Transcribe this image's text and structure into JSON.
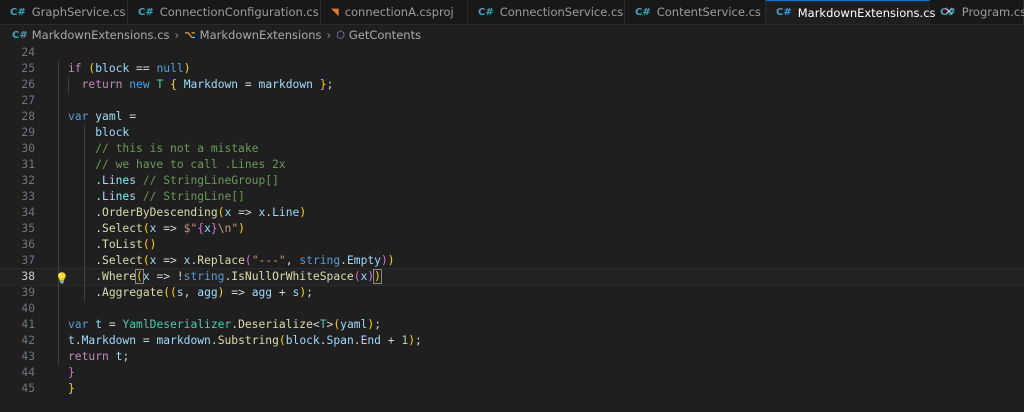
{
  "tabs": [
    {
      "label": "GraphService.cs",
      "icon": "csharp-icon",
      "glyph": "C#",
      "color": "#519aba",
      "active": false
    },
    {
      "label": "ConnectionConfiguration.cs",
      "icon": "csharp-icon",
      "glyph": "C#",
      "color": "#519aba",
      "active": false
    },
    {
      "label": "connectionA.csproj",
      "icon": "rss-icon",
      "glyph": "◥",
      "color": "#e37933",
      "active": false
    },
    {
      "label": "ConnectionService.cs",
      "icon": "csharp-icon",
      "glyph": "C#",
      "color": "#519aba",
      "active": false
    },
    {
      "label": "ContentService.cs",
      "icon": "csharp-icon",
      "glyph": "C#",
      "color": "#519aba",
      "active": false
    },
    {
      "label": "MarkdownExtensions.cs",
      "icon": "csharp-icon",
      "glyph": "C#",
      "color": "#519aba",
      "active": true
    },
    {
      "label": "Program.cs",
      "icon": "csharp-icon",
      "glyph": "C#",
      "color": "#519aba",
      "active": false
    }
  ],
  "close_glyph": "✕",
  "breadcrumb": [
    {
      "label": "MarkdownExtensions.cs",
      "icon": "csharp-icon",
      "glyph": "C#",
      "color": "#519aba"
    },
    {
      "label": "MarkdownExtensions",
      "icon": "class-icon",
      "glyph": "⌥",
      "color": "#ee9d28"
    },
    {
      "label": "GetContents",
      "icon": "method-icon",
      "glyph": "⬡",
      "color": "#b180d7"
    }
  ],
  "breadcrumb_separator": "›",
  "lightbulb": "💡",
  "current_line": 38,
  "lines": [
    {
      "n": "24",
      "tokens": []
    },
    {
      "n": "25",
      "tokens": [
        [
          "ctl",
          "if"
        ],
        [
          "pl",
          " "
        ],
        [
          "b1",
          "("
        ],
        [
          "var",
          "block"
        ],
        [
          "pl",
          " == "
        ],
        [
          "kw",
          "null"
        ],
        [
          "b1",
          ")"
        ]
      ]
    },
    {
      "n": "26",
      "tokens": [
        [
          "pl",
          "  "
        ],
        [
          "ctl",
          "return"
        ],
        [
          "pl",
          " "
        ],
        [
          "kw",
          "new"
        ],
        [
          "pl",
          " "
        ],
        [
          "ty",
          "T"
        ],
        [
          "pl",
          " "
        ],
        [
          "b1",
          "{"
        ],
        [
          "pl",
          " "
        ],
        [
          "var",
          "Markdown"
        ],
        [
          "pl",
          " = "
        ],
        [
          "var",
          "markdown"
        ],
        [
          "pl",
          " "
        ],
        [
          "b1",
          "}"
        ],
        [
          "pl",
          ";"
        ]
      ]
    },
    {
      "n": "27",
      "tokens": []
    },
    {
      "n": "28",
      "tokens": [
        [
          "kw",
          "var"
        ],
        [
          "pl",
          " "
        ],
        [
          "var",
          "yaml"
        ],
        [
          "pl",
          " ="
        ]
      ]
    },
    {
      "n": "29",
      "tokens": [
        [
          "pl",
          "    "
        ],
        [
          "var",
          "block"
        ]
      ]
    },
    {
      "n": "30",
      "tokens": [
        [
          "pl",
          "    "
        ],
        [
          "com",
          "// this is not a mistake"
        ]
      ]
    },
    {
      "n": "31",
      "tokens": [
        [
          "pl",
          "    "
        ],
        [
          "com",
          "// we have to call .Lines 2x"
        ]
      ]
    },
    {
      "n": "32",
      "tokens": [
        [
          "pl",
          "    ."
        ],
        [
          "var",
          "Lines"
        ],
        [
          "pl",
          " "
        ],
        [
          "com",
          "// StringLineGroup[]"
        ]
      ]
    },
    {
      "n": "33",
      "tokens": [
        [
          "pl",
          "    ."
        ],
        [
          "var",
          "Lines"
        ],
        [
          "pl",
          " "
        ],
        [
          "com",
          "// StringLine[]"
        ]
      ]
    },
    {
      "n": "34",
      "tokens": [
        [
          "pl",
          "    ."
        ],
        [
          "fn",
          "OrderByDescending"
        ],
        [
          "b1",
          "("
        ],
        [
          "var",
          "x"
        ],
        [
          "pl",
          " => "
        ],
        [
          "var",
          "x"
        ],
        [
          "pl",
          "."
        ],
        [
          "var",
          "Line"
        ],
        [
          "b1",
          ")"
        ]
      ]
    },
    {
      "n": "35",
      "tokens": [
        [
          "pl",
          "    ."
        ],
        [
          "fn",
          "Select"
        ],
        [
          "b1",
          "("
        ],
        [
          "var",
          "x"
        ],
        [
          "pl",
          " => "
        ],
        [
          "str",
          "$\""
        ],
        [
          "b2",
          "{"
        ],
        [
          "var",
          "x"
        ],
        [
          "b2",
          "}"
        ],
        [
          "str",
          "\\n\""
        ],
        [
          "b1",
          ")"
        ]
      ]
    },
    {
      "n": "36",
      "tokens": [
        [
          "pl",
          "    ."
        ],
        [
          "fn",
          "ToList"
        ],
        [
          "b1",
          "()"
        ]
      ]
    },
    {
      "n": "37",
      "tokens": [
        [
          "pl",
          "    ."
        ],
        [
          "fn",
          "Select"
        ],
        [
          "b1",
          "("
        ],
        [
          "var",
          "x"
        ],
        [
          "pl",
          " => "
        ],
        [
          "var",
          "x"
        ],
        [
          "pl",
          "."
        ],
        [
          "fn",
          "Replace"
        ],
        [
          "b2",
          "("
        ],
        [
          "str",
          "\"---\""
        ],
        [
          "pl",
          ", "
        ],
        [
          "kw",
          "string"
        ],
        [
          "pl",
          "."
        ],
        [
          "var",
          "Empty"
        ],
        [
          "b2",
          ")"
        ],
        [
          "b1",
          ")"
        ]
      ]
    },
    {
      "n": "38",
      "tokens": [
        [
          "pl",
          "    ."
        ],
        [
          "fn",
          "Where"
        ],
        [
          "br",
          "("
        ],
        [
          "var",
          "x"
        ],
        [
          "pl",
          " => !"
        ],
        [
          "kw",
          "string"
        ],
        [
          "pl",
          "."
        ],
        [
          "fn",
          "IsNullOrWhiteSpace"
        ],
        [
          "b2",
          "("
        ],
        [
          "var",
          "x"
        ],
        [
          "b2",
          ")"
        ],
        [
          "br",
          ")"
        ]
      ]
    },
    {
      "n": "39",
      "tokens": [
        [
          "pl",
          "    ."
        ],
        [
          "fn",
          "Aggregate"
        ],
        [
          "b1",
          "(("
        ],
        [
          "var",
          "s"
        ],
        [
          "pl",
          ", "
        ],
        [
          "var",
          "agg"
        ],
        [
          "b1",
          ")"
        ],
        [
          "pl",
          " => "
        ],
        [
          "var",
          "agg"
        ],
        [
          "pl",
          " + "
        ],
        [
          "var",
          "s"
        ],
        [
          "b1",
          ")"
        ],
        [
          "pl",
          ";"
        ]
      ]
    },
    {
      "n": "40",
      "tokens": []
    },
    {
      "n": "41",
      "tokens": [
        [
          "kw",
          "var"
        ],
        [
          "pl",
          " "
        ],
        [
          "var",
          "t"
        ],
        [
          "pl",
          " = "
        ],
        [
          "ty",
          "YamlDeserializer"
        ],
        [
          "pl",
          "."
        ],
        [
          "fn",
          "Deserialize"
        ],
        [
          "pl",
          "<"
        ],
        [
          "ty",
          "T"
        ],
        [
          "pl",
          ">"
        ],
        [
          "b1",
          "("
        ],
        [
          "var",
          "yaml"
        ],
        [
          "b1",
          ")"
        ],
        [
          "pl",
          ";"
        ]
      ]
    },
    {
      "n": "42",
      "tokens": [
        [
          "var",
          "t"
        ],
        [
          "pl",
          "."
        ],
        [
          "var",
          "Markdown"
        ],
        [
          "pl",
          " = "
        ],
        [
          "var",
          "markdown"
        ],
        [
          "pl",
          "."
        ],
        [
          "fn",
          "Substring"
        ],
        [
          "b1",
          "("
        ],
        [
          "var",
          "block"
        ],
        [
          "pl",
          "."
        ],
        [
          "var",
          "Span"
        ],
        [
          "pl",
          "."
        ],
        [
          "var",
          "End"
        ],
        [
          "pl",
          " + "
        ],
        [
          "num",
          "1"
        ],
        [
          "b1",
          ")"
        ],
        [
          "pl",
          ";"
        ]
      ]
    },
    {
      "n": "43",
      "tokens": [
        [
          "ctl",
          "return"
        ],
        [
          "pl",
          " "
        ],
        [
          "var",
          "t"
        ],
        [
          "pl",
          ";"
        ]
      ]
    },
    {
      "n": "44",
      "tokens": [
        [
          "b2",
          "}"
        ]
      ]
    },
    {
      "n": "45",
      "tokens": [
        [
          "b1",
          "}"
        ]
      ]
    }
  ]
}
